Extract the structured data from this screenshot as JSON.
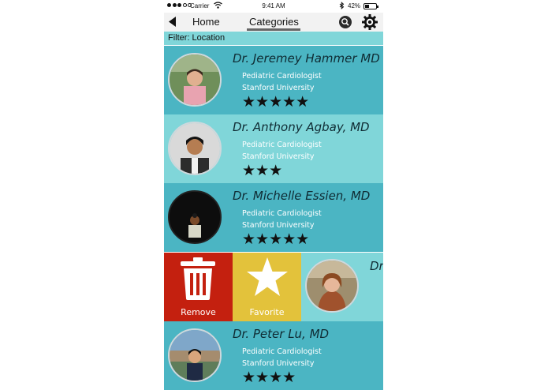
{
  "status_bar": {
    "carrier": "Carrier",
    "time": "9:41 AM",
    "battery": "42%",
    "battery_level": 0.42
  },
  "nav": {
    "back_icon": "back-arrow-icon",
    "home_label": "Home",
    "active_tab_label": "Categories",
    "search_icon": "search-icon",
    "settings_icon": "gear-icon"
  },
  "filter_label": "Filter: Location",
  "doctors": [
    {
      "name": "Dr. Jeremey Hammer MD",
      "specialty": "Pediatric Cardiologist",
      "university": "Stanford University",
      "stars": "★★★★★",
      "rating": 5
    },
    {
      "name": "Dr. Anthony Agbay, MD",
      "specialty": "Pediatric Cardiologist",
      "university": "Stanford University",
      "stars": "★★★",
      "rating": 3
    },
    {
      "name": "Dr. Michelle Essien, MD",
      "specialty": "Pediatric Cardiologist",
      "university": "Stanford University",
      "stars": "★★★★★",
      "rating": 5
    },
    {
      "name": "Dr. Peter Lu, MD",
      "specialty": "Pediatric Cardiologist",
      "university": "Stanford University",
      "stars": "★★★★",
      "rating": 4
    }
  ],
  "swiped_row": {
    "remove_label": "Remove",
    "favorite_label": "Favorite",
    "peek_name": "Dr"
  },
  "colors": {
    "row_dark": "#4bb5c3",
    "row_light": "#80d6d9",
    "remove": "#c4200f",
    "favorite": "#e3c23b"
  }
}
